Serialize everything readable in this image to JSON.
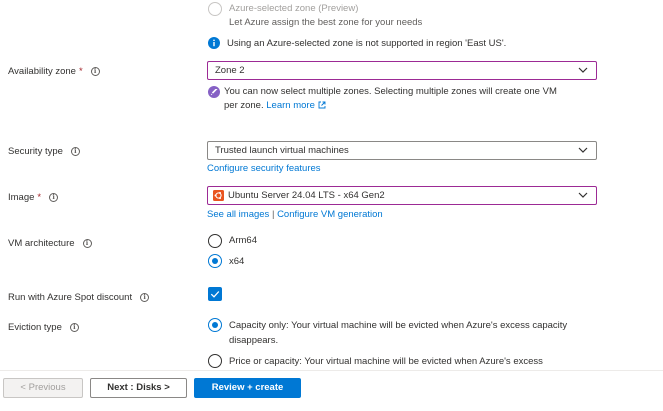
{
  "zone_options": {
    "azure_selected_label": "Azure-selected zone (Preview)",
    "azure_selected_desc": "Let Azure assign the best zone for your needs",
    "not_supported_notice": "Using an Azure-selected zone is not supported in region 'East US'."
  },
  "availability_zone": {
    "label": "Availability zone",
    "required": "*",
    "value": "Zone 2",
    "multi_zone_notice": "You can now select multiple zones. Selecting multiple zones will create one VM",
    "multi_zone_notice_line2": "per zone.",
    "learn_more": "Learn more"
  },
  "security_type": {
    "label": "Security type",
    "value": "Trusted launch virtual machines",
    "configure_link": "Configure security features"
  },
  "image": {
    "label": "Image",
    "required": "*",
    "value": "Ubuntu Server 24.04 LTS - x64 Gen2",
    "see_all_link": "See all images",
    "separator": "|",
    "configure_link": "Configure VM generation"
  },
  "vm_architecture": {
    "label": "VM architecture",
    "options": [
      "Arm64",
      "x64"
    ],
    "selected": "x64"
  },
  "spot": {
    "label": "Run with Azure Spot discount",
    "checked": true
  },
  "eviction": {
    "label": "Eviction type",
    "option1_line1": "Capacity only: Your virtual machine will be evicted when Azure's excess capacity",
    "option1_line2": "disappears.",
    "option2_partial": "Price or capacity: Your virtual machine will be evicted when Azure's excess"
  },
  "footer": {
    "prev_label": "< Previous",
    "next_label": "Next : Disks >",
    "review_label": "Review + create"
  },
  "colors": {
    "accent": "#0078d4",
    "focus_border": "#9c2a95",
    "required": "#a4262c",
    "ubuntu": "#e95420",
    "notice_purple": "#8661c5"
  }
}
